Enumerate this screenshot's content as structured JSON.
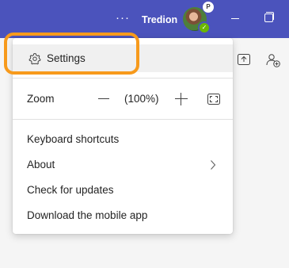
{
  "titlebar": {
    "more_label": "···",
    "org_name": "Tredion",
    "avatar_badge": "P",
    "presence_mark": "✓",
    "bg_color": "#4b53bc"
  },
  "menu": {
    "settings_label": "Settings",
    "zoom_label": "Zoom",
    "zoom_value": "(100%)",
    "items": [
      {
        "label": "Keyboard shortcuts"
      },
      {
        "label": "About"
      },
      {
        "label": "Check for updates"
      },
      {
        "label": "Download the mobile app"
      }
    ]
  },
  "icons": {
    "settings": "gear-icon",
    "zoom_out": "minus-icon",
    "zoom_in": "plus-icon",
    "fullscreen": "fullscreen-icon",
    "about_chevron": "chevron-right-icon",
    "share": "share-screen-icon",
    "people": "add-people-icon"
  },
  "highlight_color": "#f79a1c"
}
